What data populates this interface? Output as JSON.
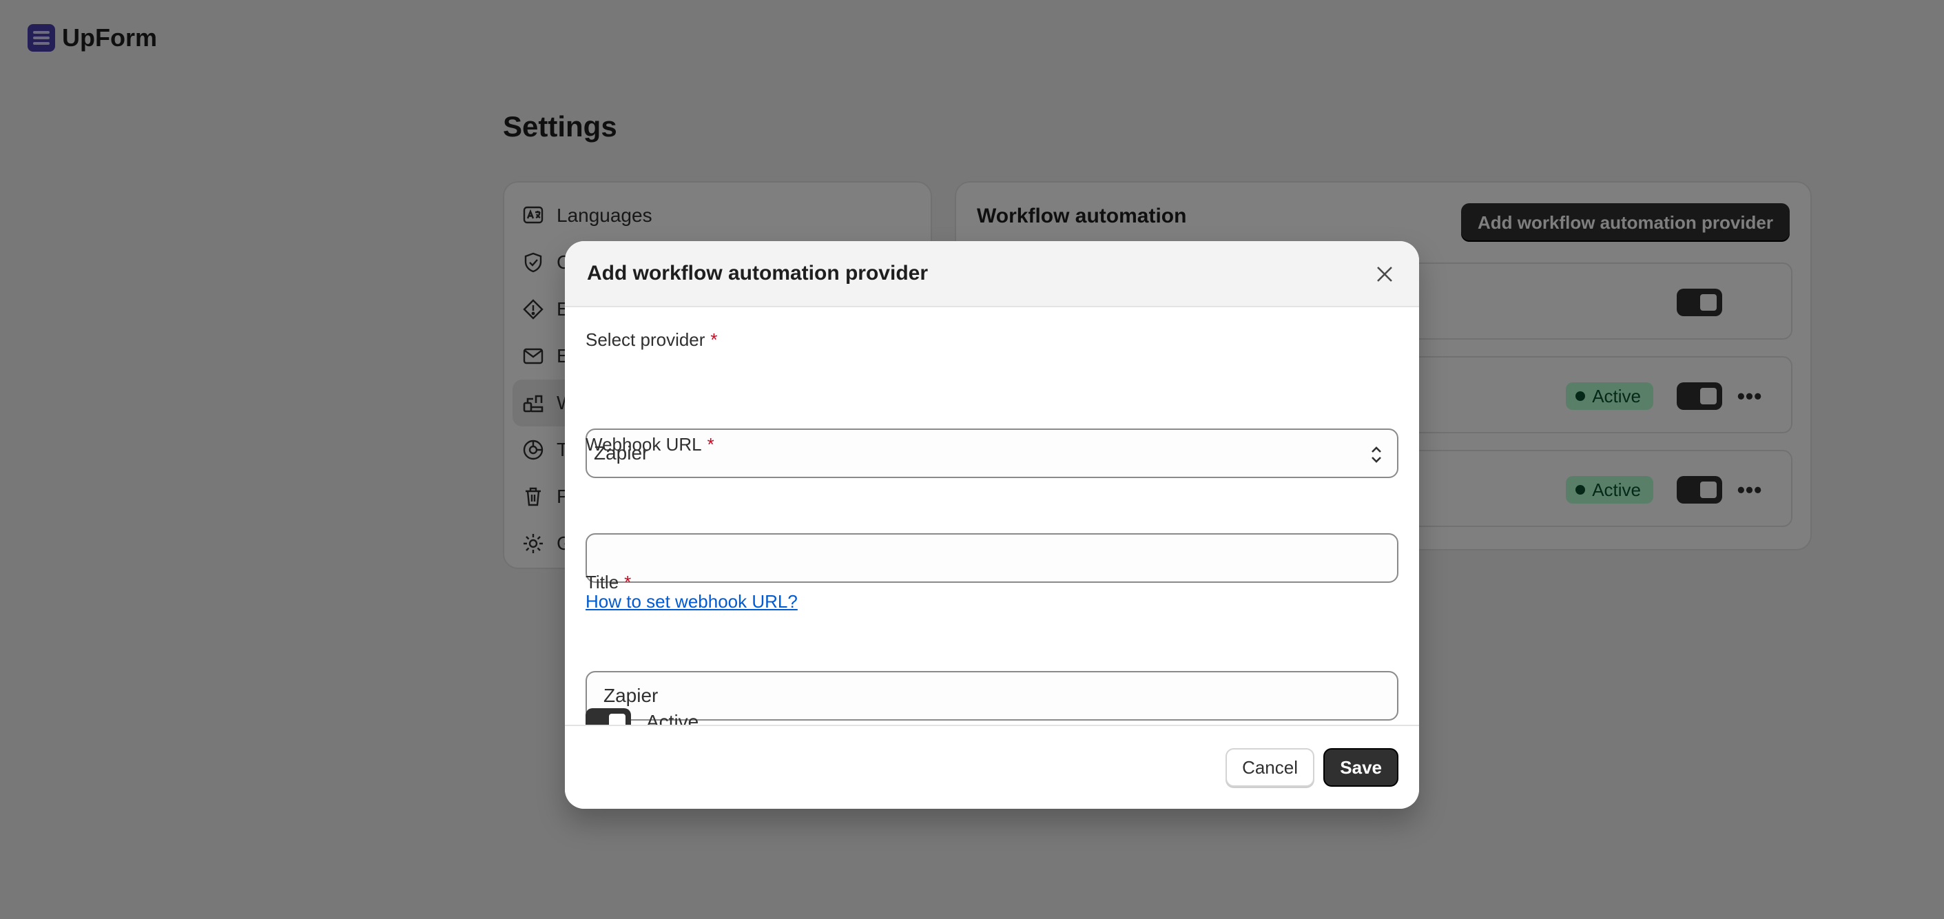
{
  "app": {
    "name": "UpForm",
    "logo_icon": "upform-logo-icon"
  },
  "page": {
    "title": "Settings"
  },
  "settings_nav": {
    "items": [
      {
        "label": "Languages",
        "icon": "languages-icon",
        "selected": false
      },
      {
        "label": "C",
        "icon": "shield-check-icon",
        "selected": false
      },
      {
        "label": "E",
        "icon": "alert-diamond-icon",
        "selected": false
      },
      {
        "label": "E",
        "icon": "envelope-icon",
        "selected": false
      },
      {
        "label": "W",
        "icon": "workflow-icon",
        "selected": true
      },
      {
        "label": "T",
        "icon": "theme-icon",
        "selected": false
      },
      {
        "label": "F",
        "icon": "trash-icon",
        "selected": false
      },
      {
        "label": "G",
        "icon": "gear-icon",
        "selected": false
      }
    ]
  },
  "workflow": {
    "title": "Workflow automation",
    "add_button": "Add workflow automation provider",
    "rows": [
      {
        "status": "",
        "toggle_on": true
      },
      {
        "status": "Active",
        "toggle_on": true
      },
      {
        "status": "Active",
        "toggle_on": true
      }
    ],
    "more_label": "•••"
  },
  "modal": {
    "title": "Add workflow automation provider",
    "close_icon": "close-icon",
    "provider": {
      "label": "Select provider",
      "required_mark": "*",
      "value": "Zapier"
    },
    "webhook": {
      "label": "Webhook URL",
      "required_mark": "*",
      "value": "",
      "help_link": "How to set webhook URL?"
    },
    "title_field": {
      "label": "Title",
      "required_mark": "*",
      "value": "Zapier"
    },
    "active": {
      "label": "Active",
      "on": true
    },
    "cancel_label": "Cancel",
    "save_label": "Save"
  },
  "colors": {
    "overlay": "rgba(0,0,0,0.5)",
    "primary_button": "#303030",
    "badge_bg": "#b4fed2",
    "badge_text": "#0c5132",
    "required": "#c70a24",
    "link": "#005bd3",
    "brand": "#4b3fae"
  }
}
